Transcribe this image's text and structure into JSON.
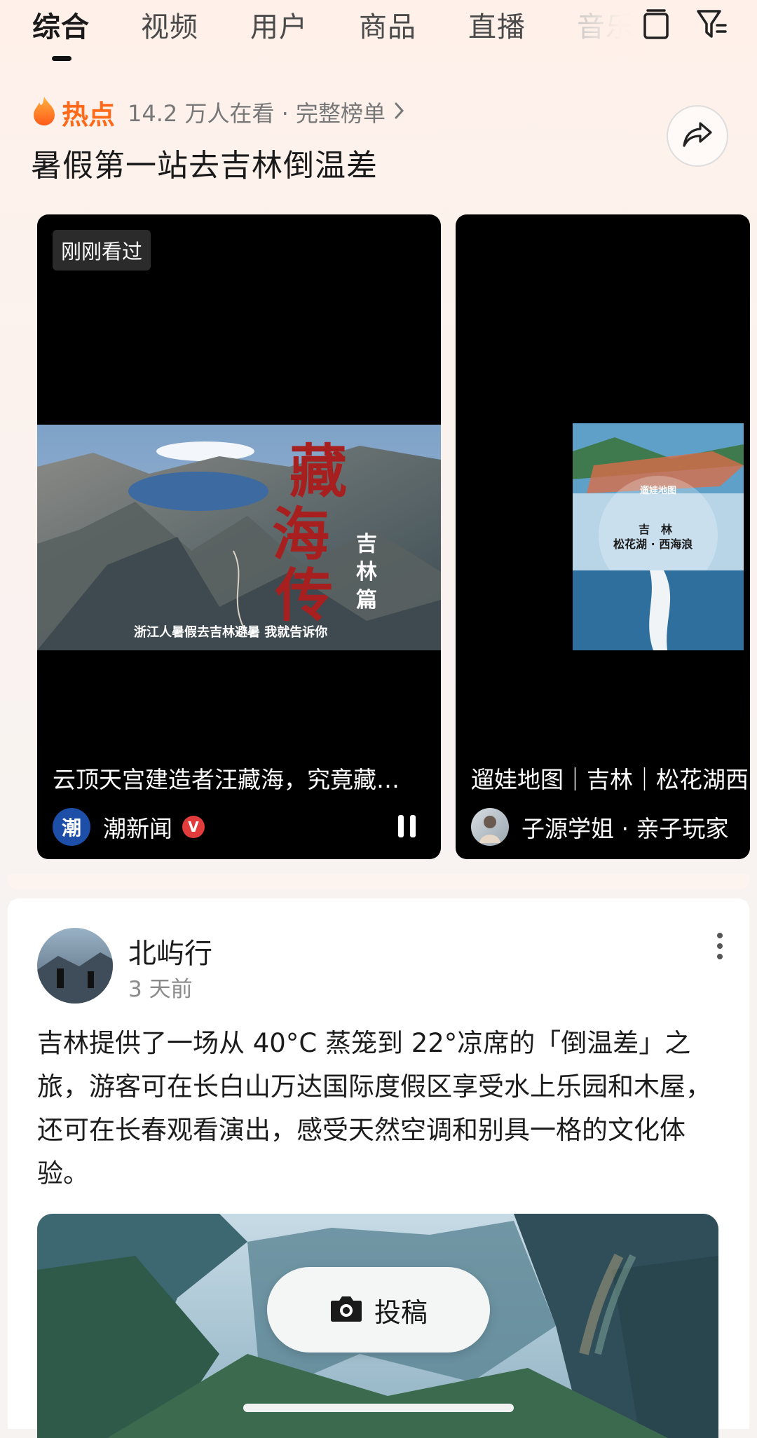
{
  "tabs": [
    {
      "label": "综合",
      "active": true
    },
    {
      "label": "视频"
    },
    {
      "label": "用户"
    },
    {
      "label": "商品"
    },
    {
      "label": "直播"
    },
    {
      "label": "音乐"
    }
  ],
  "header_icons": [
    "copy-icon",
    "filter-icon"
  ],
  "hot": {
    "label": "热点",
    "meta": "14.2 万人在看 · 完整榜单",
    "title": "暑假第一站去吉林倒温差"
  },
  "cards": [
    {
      "badge": "刚刚看过",
      "caption": "云顶天宫建造者汪藏海，究竟藏…",
      "author": "潮新闻",
      "avatar_text": "潮",
      "verified_mark": "V",
      "thumb_title": "藏海传",
      "thumb_sub": "—吉林篇",
      "thumb_subtitle": "浙江人暑假去吉林避暑 我就告诉你"
    },
    {
      "caption": "遛娃地图｜吉林｜松花湖西",
      "author": "子源学姐 · 亲子玩家",
      "thumb_label1": "遛娃地图",
      "thumb_label2": "吉　林",
      "thumb_label3": "松花湖 · 西海浪"
    }
  ],
  "post": {
    "name": "北屿行",
    "time": "3 天前",
    "text": "吉林提供了一场从 40°C 蒸笼到 22°凉席的「倒温差」之旅，游客可在长白山万达国际度假区享受水上乐园和木屋，还可在长春观看演出，感受天然空调和别具一格的文化体验。"
  },
  "submit": {
    "label": "投稿"
  },
  "colors": {
    "accent": "#ff6a1a",
    "verified": "#e23b3b",
    "background": "#f7f3f1"
  }
}
